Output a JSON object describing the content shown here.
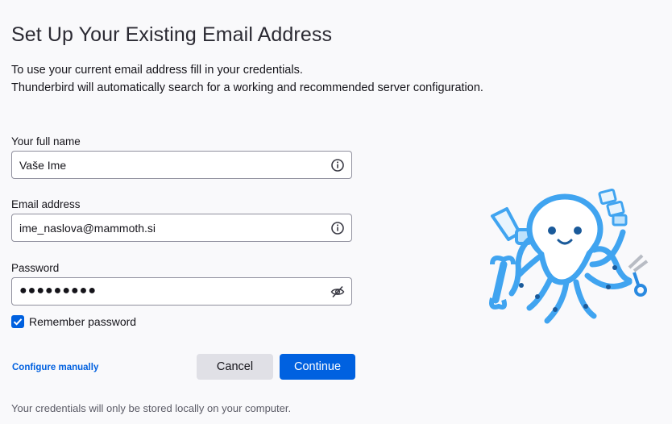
{
  "page": {
    "title": "Set Up Your Existing Email Address",
    "intro_line1": "To use your current email address fill in your credentials.",
    "intro_line2": "Thunderbird will automatically search for a working and recommended server configuration."
  },
  "form": {
    "full_name": {
      "label": "Your full name",
      "value": "Vaše Ime",
      "icon": "info-icon"
    },
    "email": {
      "label": "Email address",
      "value": "ime_naslova@mammoth.si",
      "icon": "info-icon"
    },
    "password": {
      "label": "Password",
      "value": "●●●●●●●●●",
      "icon": "eye-slash-icon"
    },
    "remember": {
      "label": "Remember password",
      "checked": true
    }
  },
  "actions": {
    "configure_manually": "Configure manually",
    "cancel": "Cancel",
    "continue": "Continue"
  },
  "footer": {
    "note": "Your credentials will only be stored locally on your computer."
  },
  "colors": {
    "accent": "#0061e0",
    "link": "#0060df",
    "illustration_blue": "#40a4f0"
  }
}
